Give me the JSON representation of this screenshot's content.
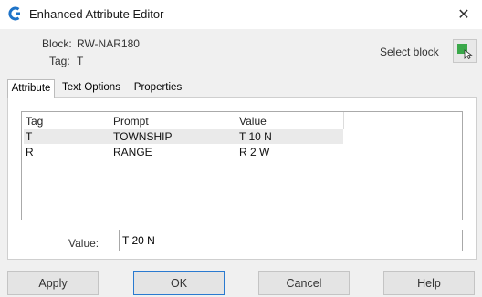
{
  "window": {
    "title": "Enhanced Attribute Editor",
    "close_glyph": "✕"
  },
  "block_info": {
    "block_label": "Block:",
    "block_name": "RW-NAR180",
    "tag_label": "Tag:",
    "tag_value": "T"
  },
  "select_block": {
    "label": "Select block",
    "icon": "select-block-icon",
    "icon_color": "#3aa84a"
  },
  "tabs": [
    {
      "label": "Attribute",
      "active": true
    },
    {
      "label": "Text Options",
      "active": false
    },
    {
      "label": "Properties",
      "active": false
    }
  ],
  "attribute_table": {
    "columns": [
      "Tag",
      "Prompt",
      "Value"
    ],
    "rows": [
      {
        "tag": "T",
        "prompt": "TOWNSHIP",
        "value": "T 10 N",
        "selected": true
      },
      {
        "tag": "R",
        "prompt": "RANGE",
        "value": "R 2 W",
        "selected": false
      }
    ]
  },
  "value_field": {
    "label": "Value:",
    "value": "T 20 N"
  },
  "buttons": {
    "apply": "Apply",
    "ok": "OK",
    "cancel": "Cancel",
    "help": "Help"
  },
  "colors": {
    "accent": "#2a7ad0",
    "app_icon": "#1e73c8"
  }
}
